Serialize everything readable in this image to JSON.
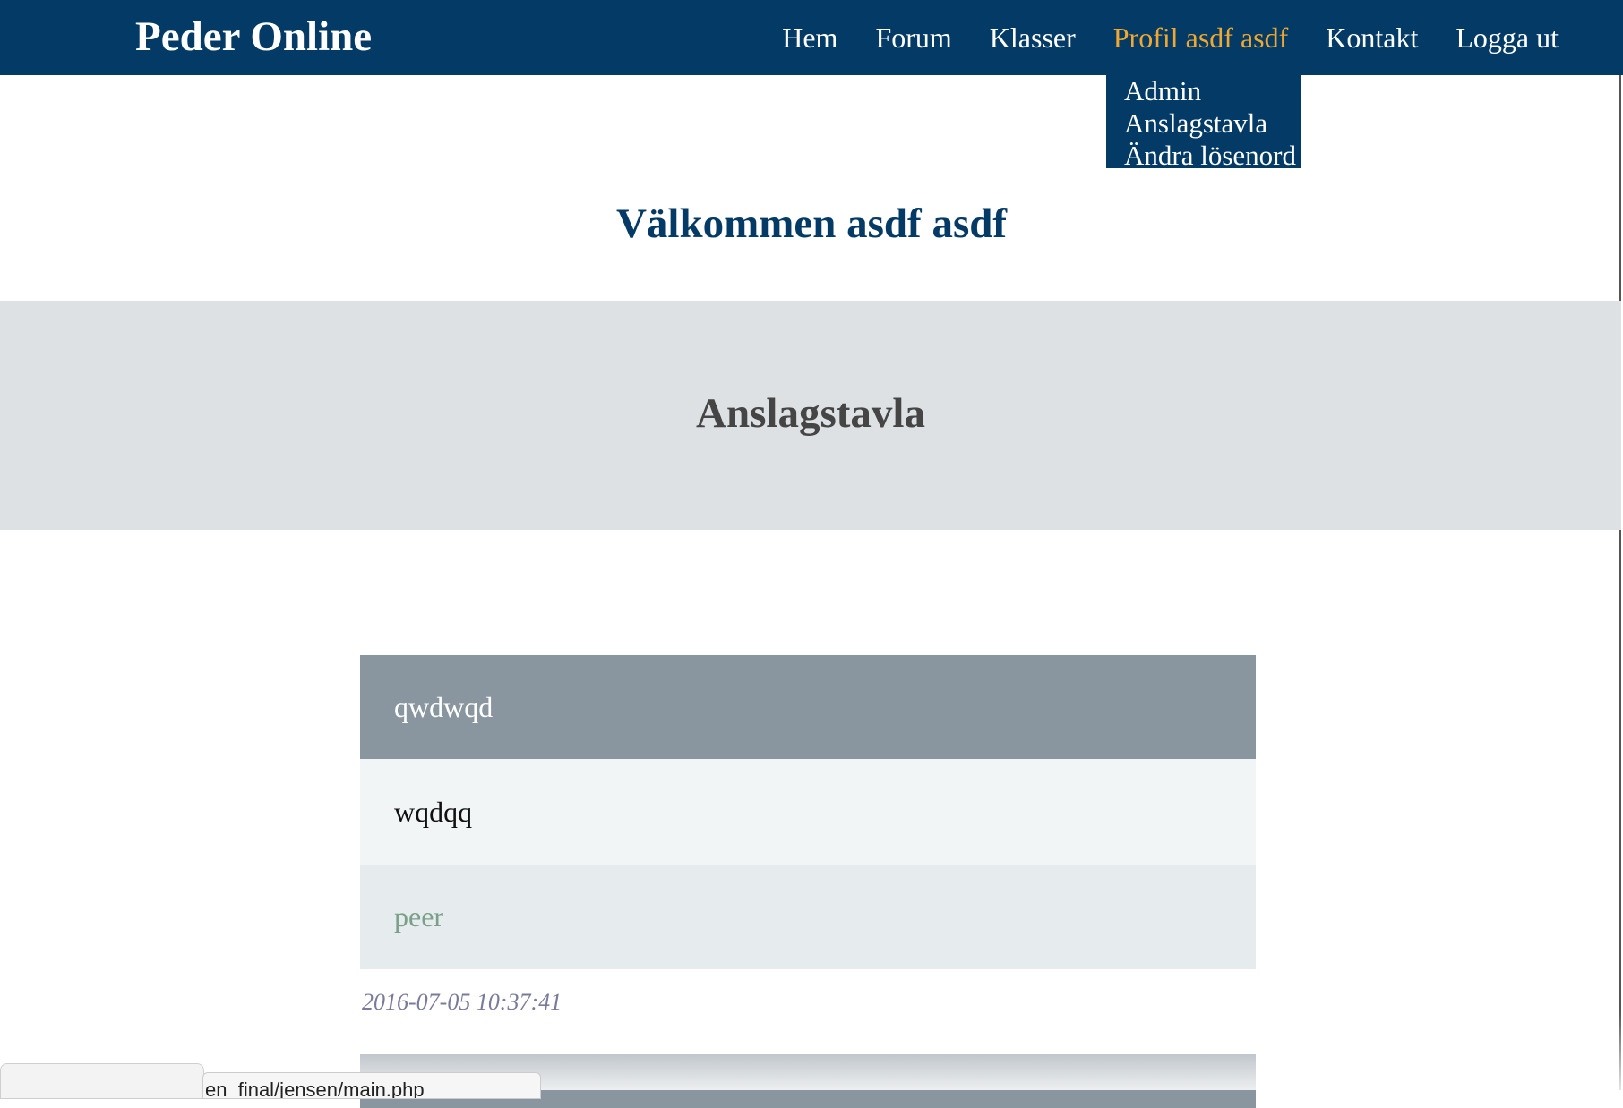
{
  "navbar": {
    "brand": "Peder Online",
    "links": [
      {
        "label": "Hem"
      },
      {
        "label": "Forum"
      },
      {
        "label": "Klasser"
      },
      {
        "label": "Profil asdf asdf"
      },
      {
        "label": "Kontakt"
      },
      {
        "label": "Logga ut"
      }
    ],
    "dropdown": [
      {
        "label": "Admin"
      },
      {
        "label": "Anslagstavla"
      },
      {
        "label": "Ändra lösenord"
      }
    ]
  },
  "welcome": "Välkommen asdf asdf",
  "banner": {
    "title": "Anslagstavla"
  },
  "post": {
    "title": "qwdwqd",
    "body": "wqdqq",
    "author": "peer",
    "date": "2016-07-05 10:37:41"
  },
  "status_bar": {
    "url_fragment": "en_final/jensen/main.php"
  },
  "colors": {
    "navbar_bg": "#033a66",
    "active_link": "#f0a830",
    "banner_bg": "#dee1e4",
    "post_header_bg": "#8a969f",
    "author_text": "#7aa08a"
  }
}
